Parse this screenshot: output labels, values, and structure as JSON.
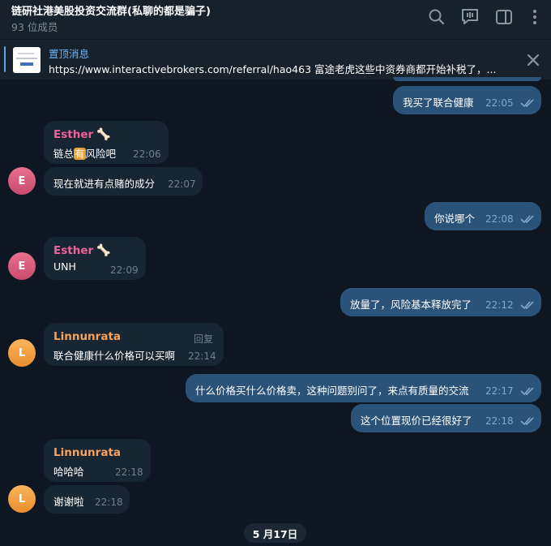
{
  "header": {
    "title": "链研社港美股投资交流群(私聊的都是骗子)",
    "members": "93 位成员",
    "icons": [
      "search-icon",
      "live-chat-icon",
      "sidebar-toggle-icon",
      "more-vertical-icon"
    ]
  },
  "pinned": {
    "label": "置顶消息",
    "text": "https://www.interactivebrokers.com/referral/hao463  富途老虎这些中资券商都开始补税了，...",
    "close_icon": "close-icon"
  },
  "messages": [
    {
      "direction": "out",
      "text": "我买了联合健康",
      "time": "22:05",
      "read": true
    },
    {
      "direction": "in",
      "sender": "Esther",
      "sender_suffix": "🦴",
      "text_before": "链总",
      "emoji_badge": "有",
      "text_after": "风险吧",
      "time": "22:06"
    },
    {
      "direction": "in",
      "text": "现在就进有点赌的成分",
      "time": "22:07",
      "avatar": "E"
    },
    {
      "direction": "out",
      "text": "你说哪个",
      "time": "22:08",
      "read": true
    },
    {
      "direction": "in",
      "sender": "Esther",
      "sender_suffix": "🦴",
      "text": "UNH",
      "time": "22:09",
      "avatar": "E"
    },
    {
      "direction": "out",
      "text": "放量了，风险基本释放完了",
      "time": "22:12",
      "read": true
    },
    {
      "direction": "in",
      "sender": "Linnunrata",
      "reply_label": "回复",
      "text": "联合健康什么价格可以买啊",
      "time": "22:14",
      "avatar": "L"
    },
    {
      "direction": "out",
      "text": "什么价格买什么价格卖，这种问题别问了，来点有质量的交流",
      "time": "22:17",
      "read": true
    },
    {
      "direction": "out",
      "text": "这个位置现价已经很好了",
      "time": "22:18",
      "read": true
    },
    {
      "direction": "in",
      "sender": "Linnunrata",
      "text": "哈哈哈",
      "time": "22:18"
    },
    {
      "direction": "in",
      "text": "谢谢啦",
      "time": "22:18",
      "avatar": "L"
    }
  ],
  "date_divider": "5 月17日",
  "colors": {
    "background": "#0e1621",
    "header": "#17212b",
    "outgoing_bubble": "#2b5278",
    "incoming_bubble": "#182533",
    "link_blue": "#6ab3f3",
    "esther_name": "#ef6298",
    "linnunrata_name": "#f7a35c"
  }
}
